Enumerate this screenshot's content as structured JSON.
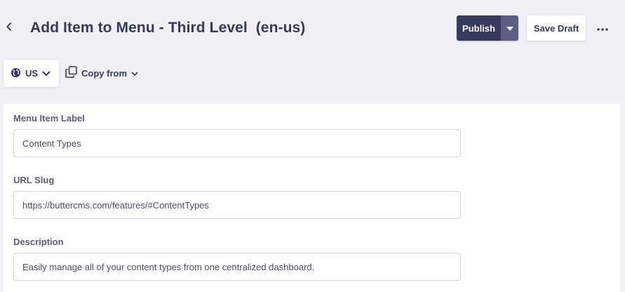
{
  "header": {
    "title": "Add Item to Menu - Third Level  (en-us)",
    "publish_label": "Publish",
    "save_draft_label": "Save Draft"
  },
  "toolbar": {
    "locale_label": "US",
    "copy_from_label": "Copy from"
  },
  "form": {
    "fields": [
      {
        "label": "Menu Item Label",
        "value": "Content Types"
      },
      {
        "label": "URL Slug",
        "value": "https://buttercms.com/features/#ContentTypes"
      },
      {
        "label": "Description",
        "value": "Easily manage all of your content types from one centralized dashboard."
      }
    ]
  },
  "icons": {
    "back": "chevron-left-icon",
    "publish_dropdown": "caret-down-icon",
    "more": "ellipsis-icon",
    "locale": "globe-icon",
    "locale_dropdown": "chevron-down-icon",
    "copy": "copy-icon",
    "copy_dropdown": "chevron-down-icon"
  },
  "colors": {
    "background": "#f0f0f6",
    "publish": "#353a5e",
    "publish_caret": "#5b6080",
    "text": "#363a5c"
  }
}
